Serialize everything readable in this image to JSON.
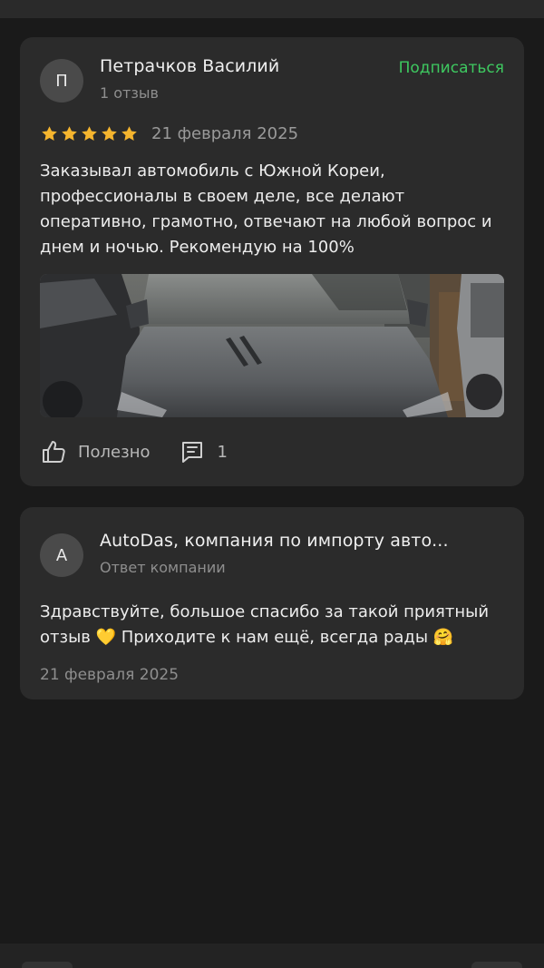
{
  "review": {
    "author_initial": "П",
    "author_name": "Петрачков Василий",
    "author_meta": "1 отзыв",
    "subscribe_label": "Подписаться",
    "rating": 5,
    "rating_max": 5,
    "date": "21 февраля 2025",
    "text": "Заказывал автомобиль с Южной Кореи, профессионалы в своем деле, все делают оперативно, грамотно, отвечают на любой вопрос и днем и ночью. Рекомендую на 100%",
    "photo_icon": "car-photo",
    "actions": {
      "helpful_label": "Полезно",
      "comments_count": "1"
    }
  },
  "reply": {
    "author_initial": "А",
    "author_name": "AutoDas, компания по импорту авто...",
    "author_meta": "Ответ компании",
    "text": "Здравствуйте, большое спасибо за такой приятный отзыв 💛 Приходите к нам ещё, всегда рады 🤗",
    "date": "21 февраля 2025"
  },
  "colors": {
    "background": "#1a1a1a",
    "card": "#2b2b2b",
    "accent_green": "#3ec960",
    "star": "#f5b52e",
    "muted_text": "#8e8e8e"
  }
}
